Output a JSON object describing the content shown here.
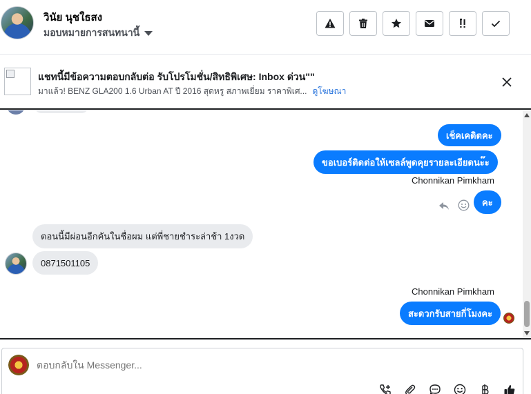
{
  "header": {
    "contact_name": "วินัย นุชใธสง",
    "assign_label": "มอบหมายการสนทนานี้",
    "toolbar": [
      {
        "icon": "warning-icon",
        "label": "Report spam"
      },
      {
        "icon": "trash-icon",
        "label": "Delete"
      },
      {
        "icon": "star-icon",
        "label": "Star"
      },
      {
        "icon": "envelope-icon",
        "label": "Mark unread"
      },
      {
        "icon": "follow-up-icon",
        "label": "Follow up"
      },
      {
        "icon": "check-icon",
        "label": "Mark done"
      }
    ]
  },
  "ad": {
    "title": "แชทนี้มีข้อความตอบกลับต่อ รับโปรโมชั่น/สิทธิพิเศษ: Inbox ด่วน\"\"",
    "description": "มาแล้ว! BENZ GLA200 1.6 Urban AT ปี 2016 สุดหรู สภาพเยี่ยม ราคาพิเศ...",
    "link_text": "ดูโฆษณา"
  },
  "messages": [
    {
      "direction": "out",
      "text": "เช็คเคดิตคะ"
    },
    {
      "direction": "out",
      "text": "ขอเบอร์ติดต่อให้เซลล์พูดคุยรายละเอียดนะ๊ะ"
    },
    {
      "direction": "out",
      "sender": "Chonnikan Pimkham",
      "text": "คะ"
    },
    {
      "direction": "in",
      "text": "ตอนนี้มีผ่อนอีกคันในชื่อผม แต่พี่ชายชำระล่าช้า 1งวด"
    },
    {
      "direction": "in",
      "text": "0871501105"
    },
    {
      "direction": "out",
      "sender": "Chonnikan Pimkham",
      "text": "สะดวกรับสายกี่โมงคะ"
    }
  ],
  "composer": {
    "placeholder": "ตอบกลับใน Messenger...",
    "tools": [
      "call-add-icon",
      "attachment-icon",
      "chat-bubble-icon",
      "emoji-icon",
      "baht-icon",
      "thumbs-up-icon"
    ]
  },
  "colors": {
    "outgoing_bubble": "#0a7cff",
    "incoming_bubble": "#e9ebee",
    "link": "#216fdb"
  }
}
